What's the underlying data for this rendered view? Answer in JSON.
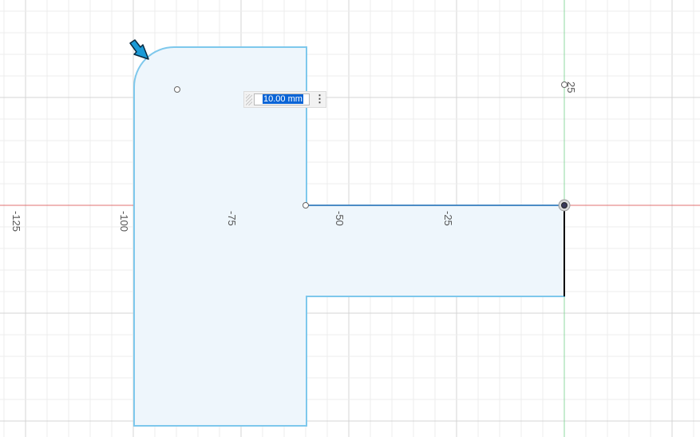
{
  "canvas": {
    "axis_labels": [
      "-125",
      "-100",
      "-75",
      "-50",
      "-25"
    ],
    "vertical_axis_label": "25",
    "colors": {
      "grid": "#e6e6e6",
      "x_axis": "#e07070",
      "y_axis": "#8fd9a0",
      "profile_fill": "#eef6fc",
      "profile_stroke": "#7ec8ec",
      "selected_edge": "#000000",
      "cursor": "#1a9ad6"
    }
  },
  "dimension_input": {
    "value": "10.00 mm",
    "menu_icon": "more-vertical-icon"
  },
  "cursor": {
    "icon": "resize-arrow-icon"
  }
}
